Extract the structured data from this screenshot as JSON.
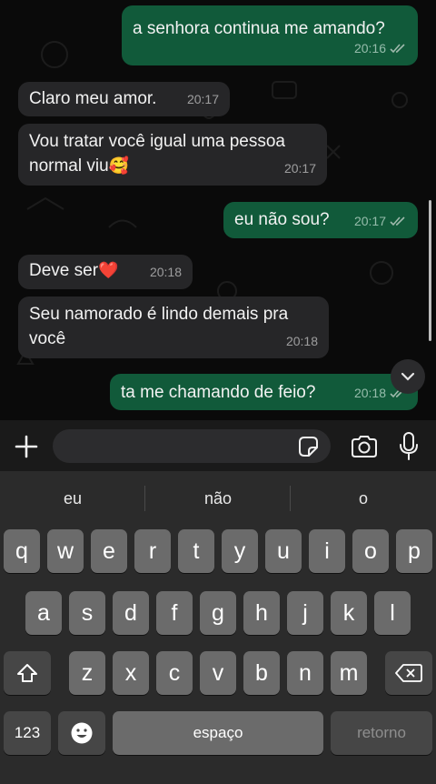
{
  "chat": {
    "messages": [
      {
        "direction": "out",
        "text": "a senhora continua me amando?",
        "time": "20:16",
        "status": "read"
      },
      {
        "direction": "in",
        "text": "Claro meu amor.",
        "time": "20:17"
      },
      {
        "direction": "in",
        "text_line1": "Vou tratar você igual uma pessoa",
        "text_line2": "normal viu",
        "emoji": "🥰",
        "time": "20:17"
      },
      {
        "direction": "out",
        "text": "eu não sou?",
        "time": "20:17",
        "status": "read"
      },
      {
        "direction": "in",
        "text": "Deve ser",
        "emoji": "❤️",
        "time": "20:18"
      },
      {
        "direction": "in",
        "text_line1": "Seu namorado é lindo demais pra",
        "text_line2": "você",
        "time": "20:18"
      },
      {
        "direction": "out",
        "text": "ta me chamando de feio?",
        "time": "20:18",
        "status": "read"
      }
    ]
  },
  "composer": {
    "input_value": "",
    "icons": [
      "plus-icon",
      "sticker-icon",
      "camera-icon",
      "microphone-icon"
    ]
  },
  "keyboard": {
    "suggestions": [
      "eu",
      "não",
      "o"
    ],
    "row1": [
      "q",
      "w",
      "e",
      "r",
      "t",
      "y",
      "u",
      "i",
      "o",
      "p"
    ],
    "row2": [
      "a",
      "s",
      "d",
      "f",
      "g",
      "h",
      "j",
      "k",
      "l"
    ],
    "row3": [
      "z",
      "x",
      "c",
      "v",
      "b",
      "n",
      "m"
    ],
    "numbers_label": "123",
    "space_label": "espaço",
    "return_label": "retorno"
  },
  "colors": {
    "incoming_bubble": "#262628",
    "outgoing_bubble": "#115a3a",
    "read_ticks": "#9fb9ac"
  }
}
